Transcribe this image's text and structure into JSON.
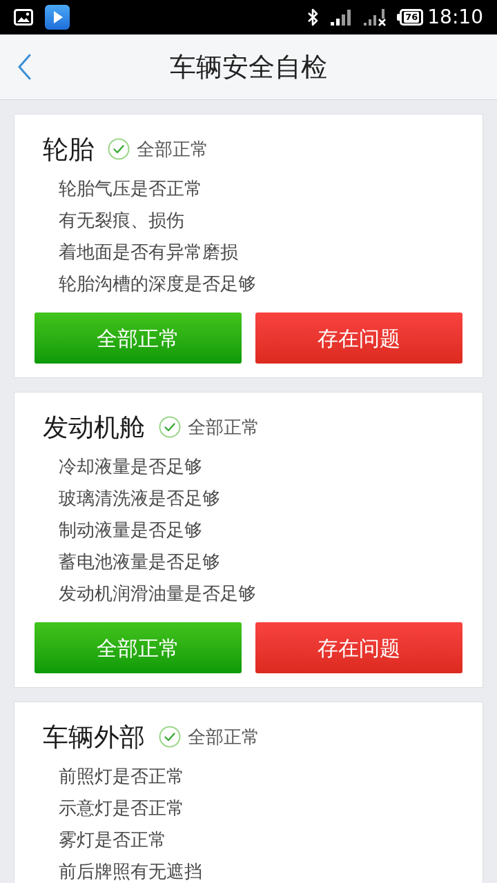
{
  "status_bar": {
    "battery": "76",
    "time": "18:10"
  },
  "nav": {
    "title": "车辆安全自检"
  },
  "sections": [
    {
      "title": "轮胎",
      "status": {
        "label": "全部正常",
        "ok": true
      },
      "items": [
        "轮胎气压是否正常",
        "有无裂痕、损伤",
        "着地面是否有异常磨损",
        "轮胎沟槽的深度是否足够"
      ],
      "buttons": [
        {
          "label": "全部正常",
          "kind": "ok"
        },
        {
          "label": "存在问题",
          "kind": "problem"
        }
      ]
    },
    {
      "title": "发动机舱",
      "status": {
        "label": "全部正常",
        "ok": true
      },
      "items": [
        "冷却液量是否足够",
        "玻璃清洗液是否足够",
        "制动液量是否足够",
        "蓄电池液量是否足够",
        "发动机润滑油量是否足够"
      ],
      "buttons": [
        {
          "label": "全部正常",
          "kind": "ok"
        },
        {
          "label": "存在问题",
          "kind": "problem"
        }
      ]
    },
    {
      "title": "车辆外部",
      "status": {
        "label": "全部正常",
        "ok": true
      },
      "items": [
        "前照灯是否正常",
        "示意灯是否正常",
        "雾灯是否正常",
        "前后牌照有无遮挡"
      ]
    }
  ]
}
